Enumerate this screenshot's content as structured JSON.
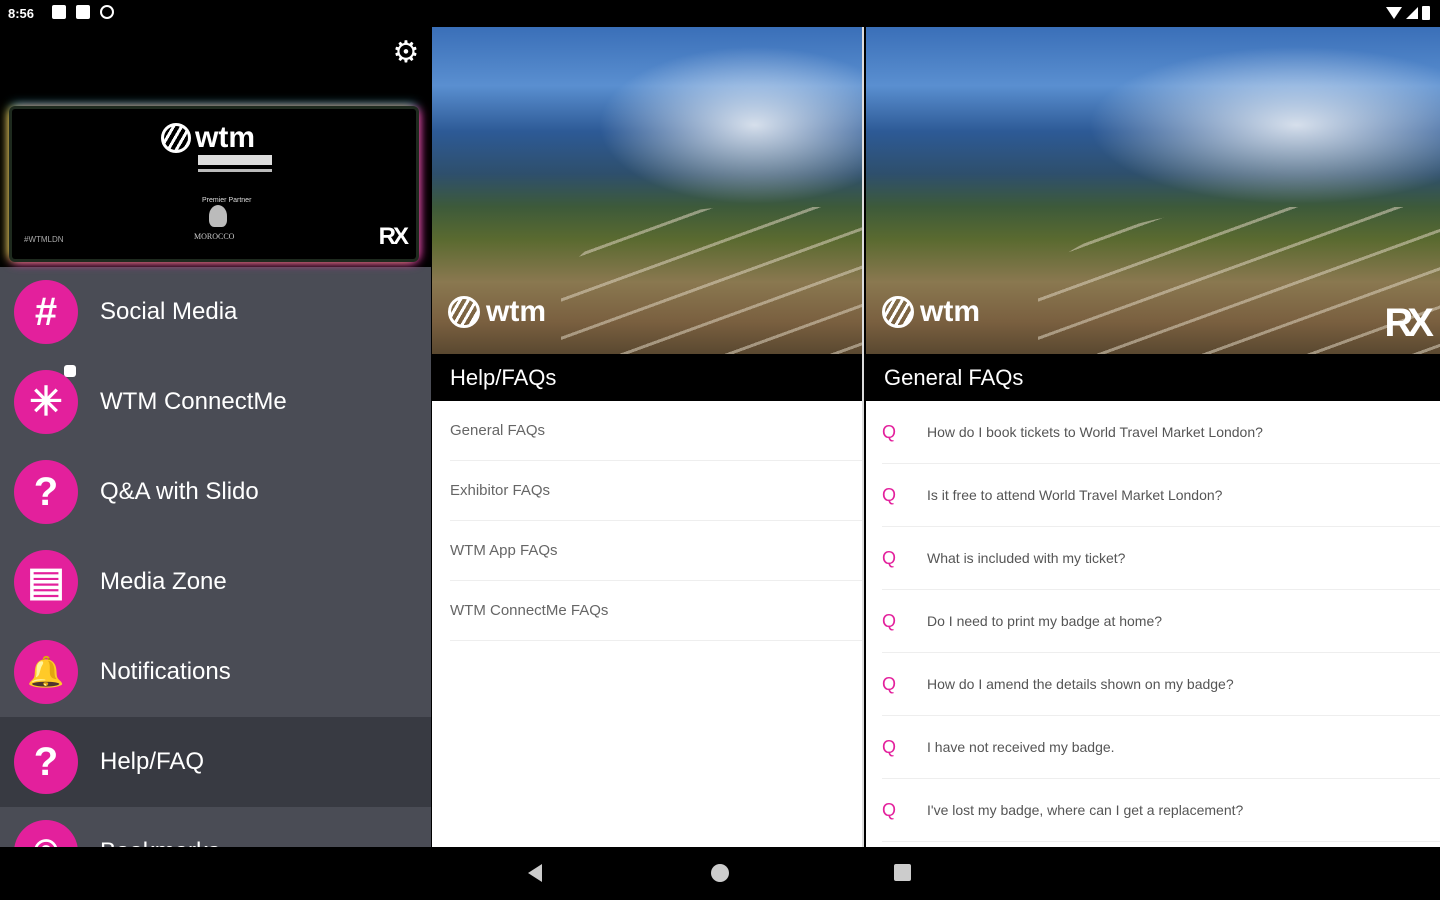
{
  "status_bar": {
    "time": "8:56"
  },
  "drawer": {
    "banner": {
      "logo_text": "wtm",
      "host_label": "Premier Partner",
      "host_country": "MOROCCO",
      "left_text": "#WTMLDN",
      "brand": "RX"
    },
    "items": [
      {
        "label": "Social Media",
        "icon": "hashtag-icon",
        "glyph": "#"
      },
      {
        "label": "WTM ConnectMe",
        "icon": "network-icon",
        "glyph": "✳"
      },
      {
        "label": "Q&A with Slido",
        "icon": "question-bubble-icon",
        "glyph": "?"
      },
      {
        "label": "Media Zone",
        "icon": "newspaper-icon",
        "glyph": "▤"
      },
      {
        "label": "Notifications",
        "icon": "bell-icon",
        "glyph": "🔔"
      },
      {
        "label": "Help/FAQ",
        "icon": "help-icon",
        "glyph": "?"
      },
      {
        "label": "Bookmarks",
        "icon": "bookmark-icon",
        "glyph": "⌾"
      }
    ],
    "selected_index": 5
  },
  "help_panel": {
    "hero_logo": "wtm",
    "title": "Help/FAQs",
    "items": [
      "General FAQs",
      "Exhibitor FAQs",
      "WTM App FAQs",
      "WTM ConnectMe FAQs"
    ]
  },
  "faq_panel": {
    "hero_logo": "wtm",
    "hero_brand": "RX",
    "title": "General FAQs",
    "q_marker": "Q",
    "questions": [
      "How do I book tickets to World Travel Market London?",
      "Is it free to attend World Travel Market London?",
      "What is included with my ticket?",
      "Do I need to print my badge at home?",
      "How do I amend the details shown on my badge?",
      "I have not received my badge.",
      "I've lost my badge, where can I get a replacement?"
    ]
  },
  "colors": {
    "accent": "#e3209c",
    "drawer_bg": "#4a4c55",
    "selected_bg": "#383a42"
  }
}
